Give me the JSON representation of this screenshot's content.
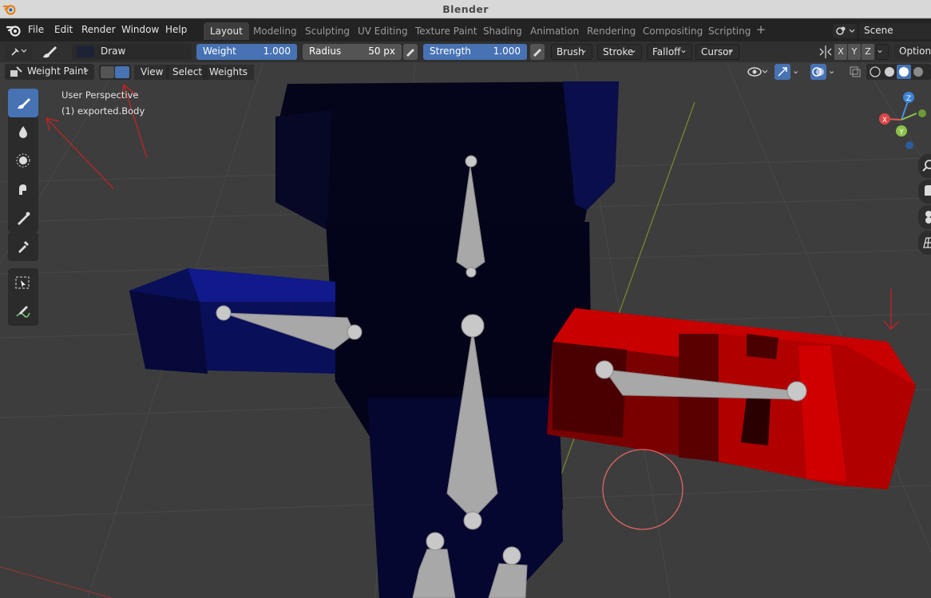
{
  "window": {
    "title": "Blender"
  },
  "menus": [
    "File",
    "Edit",
    "Render",
    "Window",
    "Help"
  ],
  "workspace_tabs": [
    {
      "label": "Layout",
      "active": true
    },
    {
      "label": "Modeling",
      "active": false
    },
    {
      "label": "Sculpting",
      "active": false
    },
    {
      "label": "UV Editing",
      "active": false
    },
    {
      "label": "Texture Paint",
      "active": false
    },
    {
      "label": "Shading",
      "active": false
    },
    {
      "label": "Animation",
      "active": false
    },
    {
      "label": "Rendering",
      "active": false
    },
    {
      "label": "Compositing",
      "active": false
    },
    {
      "label": "Scripting",
      "active": false
    }
  ],
  "workspace_add": "+",
  "scene": {
    "name": "Scene"
  },
  "tool_settings": {
    "brush_name": "Draw",
    "weight_label": "Weight",
    "weight_value": "1.000",
    "radius_label": "Radius",
    "radius_value": "50 px",
    "strength_label": "Strength",
    "strength_value": "1.000",
    "dropdowns": [
      "Brush",
      "Stroke",
      "Falloff",
      "Cursor"
    ],
    "axes": [
      "X",
      "Y",
      "Z"
    ],
    "options_label": "Options"
  },
  "viewport_header": {
    "mode": "Weight Paint",
    "menus": [
      "View",
      "Select",
      "Weights"
    ]
  },
  "viewport_overlay": {
    "perspective": "User Perspective",
    "object": "(1) exported.Body"
  },
  "gizmo": {
    "x": "X",
    "y": "Y",
    "z": "Z"
  },
  "colors": {
    "accent": "#4772b3",
    "weight_low": "#000033",
    "weight_high": "#d40000",
    "annotation": "#cc2222"
  }
}
